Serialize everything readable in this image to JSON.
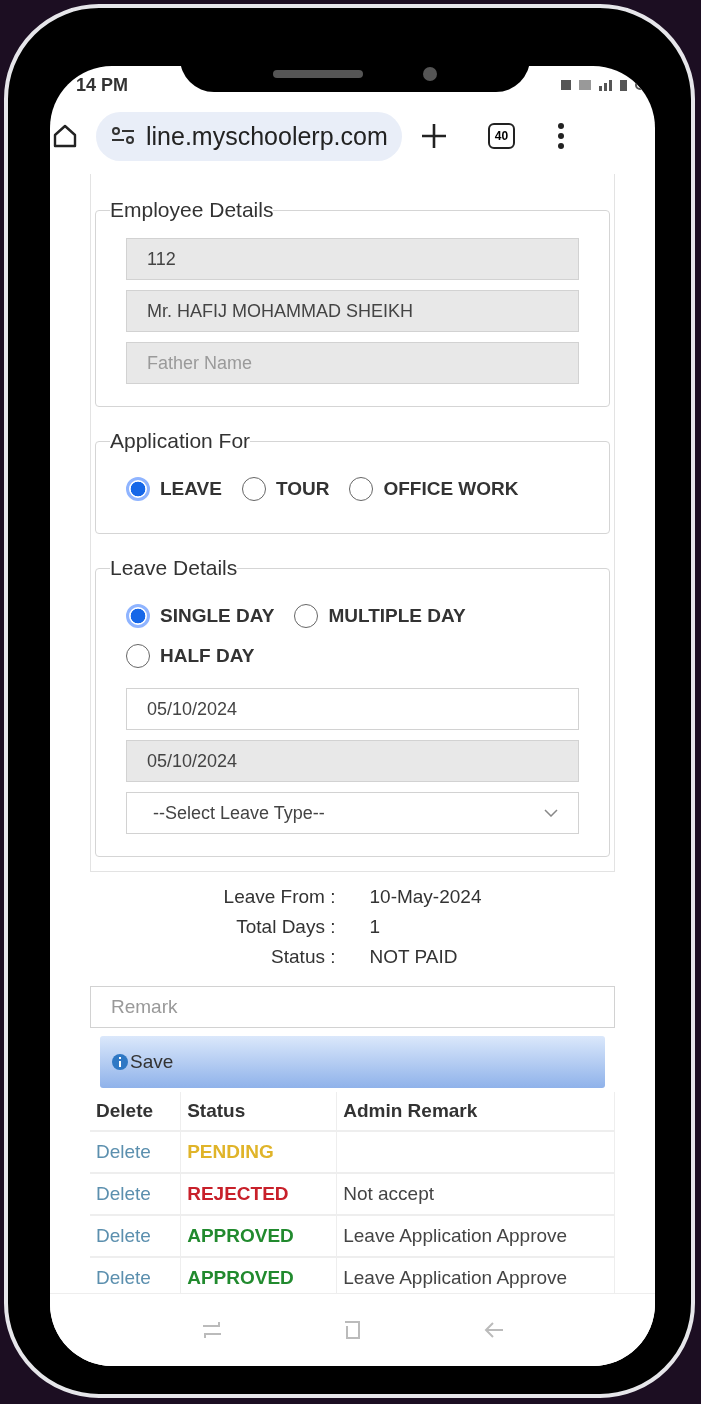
{
  "status_bar": {
    "time": "14 PM"
  },
  "browser": {
    "url": "line.myschoolerp.com",
    "tab_count": "40"
  },
  "employee_details": {
    "title": "Employee Details",
    "fields": [
      {
        "value": "112"
      },
      {
        "value": "Mr. HAFIJ MOHAMMAD SHEIKH"
      },
      {
        "placeholder": "Father Name"
      }
    ]
  },
  "application_for": {
    "title": "Application For",
    "options": [
      {
        "label": "LEAVE",
        "selected": true
      },
      {
        "label": "TOUR",
        "selected": false
      },
      {
        "label": "OFFICE WORK",
        "selected": false
      }
    ]
  },
  "leave_details": {
    "title": "Leave Details",
    "options": [
      {
        "label": "SINGLE DAY",
        "selected": true
      },
      {
        "label": "MULTIPLE DAY",
        "selected": false
      },
      {
        "label": "HALF DAY",
        "selected": false
      }
    ],
    "from_date": "05/10/2024",
    "to_date": "05/10/2024",
    "leave_type": "--Select Leave Type--"
  },
  "summary": [
    {
      "label": "Leave From :",
      "value": "10-May-2024"
    },
    {
      "label": "Total Days :",
      "value": "1"
    },
    {
      "label": "Status :",
      "value": "NOT PAID"
    }
  ],
  "remark": {
    "placeholder": "Remark"
  },
  "save_button": "Save",
  "table": {
    "columns": [
      "Delete",
      "Status",
      "Admin Remark"
    ],
    "rows": [
      {
        "action": "Delete",
        "status": "PENDING",
        "color": "#e0b429",
        "remark": ""
      },
      {
        "action": "Delete",
        "status": "REJECTED",
        "color": "#c8202a",
        "remark": "Not accept"
      },
      {
        "action": "Delete",
        "status": "APPROVED",
        "color": "#218a2e",
        "remark": "Leave Application Approve"
      },
      {
        "action": "Delete",
        "status": "APPROVED",
        "color": "#218a2e",
        "remark": "Leave Application Approve"
      }
    ]
  }
}
